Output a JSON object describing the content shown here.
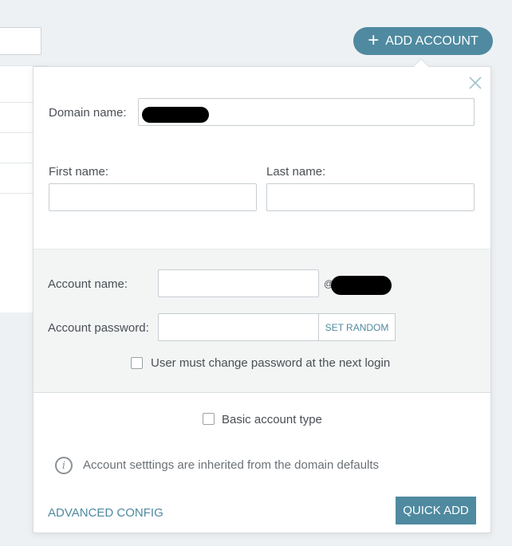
{
  "header": {
    "add_account_label": "ADD ACCOUNT",
    "add_icon": "plus-icon"
  },
  "form": {
    "domain_name_label": "Domain name:",
    "first_name_label": "First name:",
    "last_name_label": "Last name:",
    "account_name_label": "Account name:",
    "at_symbol": "@",
    "account_password_label": "Account password:",
    "set_random_label": "SET RANDOM",
    "must_change_password_label": "User must change password at the next login",
    "must_change_password_checked": false,
    "basic_account_label": "Basic account type",
    "basic_account_checked": false,
    "info_text": "Account setttings are inherited from the domain defaults",
    "advanced_config_label": "ADVANCED CONFIG",
    "quick_add_label": "QUICK ADD"
  },
  "colors": {
    "accent": "#4f8aa0",
    "text": "#4a4f54",
    "section_bg": "#f3f5f5"
  }
}
